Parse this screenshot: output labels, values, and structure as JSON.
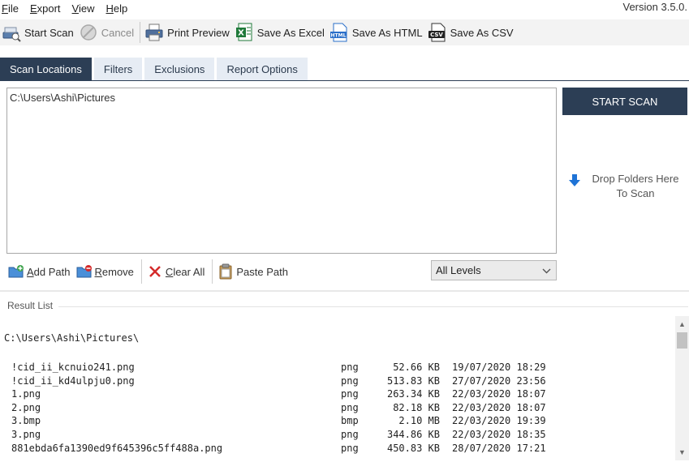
{
  "menu": {
    "items": [
      {
        "label": "File",
        "key": "F",
        "rest": "ile"
      },
      {
        "label": "Export",
        "key": "E",
        "rest": "xport"
      },
      {
        "label": "View",
        "key": "V",
        "rest": "iew"
      },
      {
        "label": "Help",
        "key": "H",
        "rest": "elp"
      }
    ],
    "version": "Version 3.5.0."
  },
  "toolbar": {
    "start_scan": "Start Scan",
    "cancel": "Cancel",
    "print_preview": "Print Preview",
    "save_excel": "Save As Excel",
    "save_html": "Save As HTML",
    "save_csv": "Save As CSV"
  },
  "tabs": [
    {
      "label": "Scan Locations",
      "active": true
    },
    {
      "label": "Filters",
      "active": false
    },
    {
      "label": "Exclusions",
      "active": false
    },
    {
      "label": "Report Options",
      "active": false
    }
  ],
  "scan": {
    "path": "C:\\Users\\Ashi\\Pictures",
    "start_button": "START SCAN",
    "drop_text_line1": "Drop Folders Here",
    "drop_text_line2": "To Scan"
  },
  "path_actions": {
    "add_path": {
      "key": "A",
      "rest": "dd Path"
    },
    "remove": {
      "key": "R",
      "rest": "emove"
    },
    "clear_all": {
      "key": "C",
      "rest": "lear All"
    },
    "paste_path": "Paste Path"
  },
  "levels": {
    "selected": "All Levels"
  },
  "results": {
    "label": "Result List",
    "root": "C:\\Users\\Ashi\\Pictures\\",
    "rows": [
      {
        "name": "!cid_ii_kcnuio241.png",
        "ext": "png",
        "size": "52.66 KB",
        "date": "19/07/2020 18:29"
      },
      {
        "name": "!cid_ii_kd4ulpju0.png",
        "ext": "png",
        "size": "513.83 KB",
        "date": "27/07/2020 23:56"
      },
      {
        "name": "1.png",
        "ext": "png",
        "size": "263.34 KB",
        "date": "22/03/2020 18:07"
      },
      {
        "name": "2.png",
        "ext": "png",
        "size": "82.18 KB",
        "date": "22/03/2020 18:07"
      },
      {
        "name": "3.bmp",
        "ext": "bmp",
        "size": "2.10 MB",
        "date": "22/03/2020 19:39"
      },
      {
        "name": "3.png",
        "ext": "png",
        "size": "344.86 KB",
        "date": "22/03/2020 18:35"
      },
      {
        "name": "881ebda6fa1390ed9f645396c5ff488a.png",
        "ext": "png",
        "size": "450.83 KB",
        "date": "28/07/2020 17:21"
      }
    ]
  },
  "icons": {
    "start_scan": "scanner-icon",
    "cancel": "cancel-circle-icon",
    "print_preview": "printer-icon",
    "save_excel": "excel-icon",
    "save_html": "html-file-icon",
    "save_csv": "csv-file-icon",
    "drop": "arrow-down-icon",
    "add_path": "add-folder-icon",
    "remove": "remove-folder-icon",
    "clear_all": "red-x-icon",
    "paste_path": "clipboard-icon"
  },
  "colors": {
    "accent_dark": "#2c3e55",
    "tab_inactive": "#e6ecf4",
    "clear_red": "#d42a2a",
    "excel_green": "#1f7a3a",
    "drop_blue": "#1e73d6"
  }
}
